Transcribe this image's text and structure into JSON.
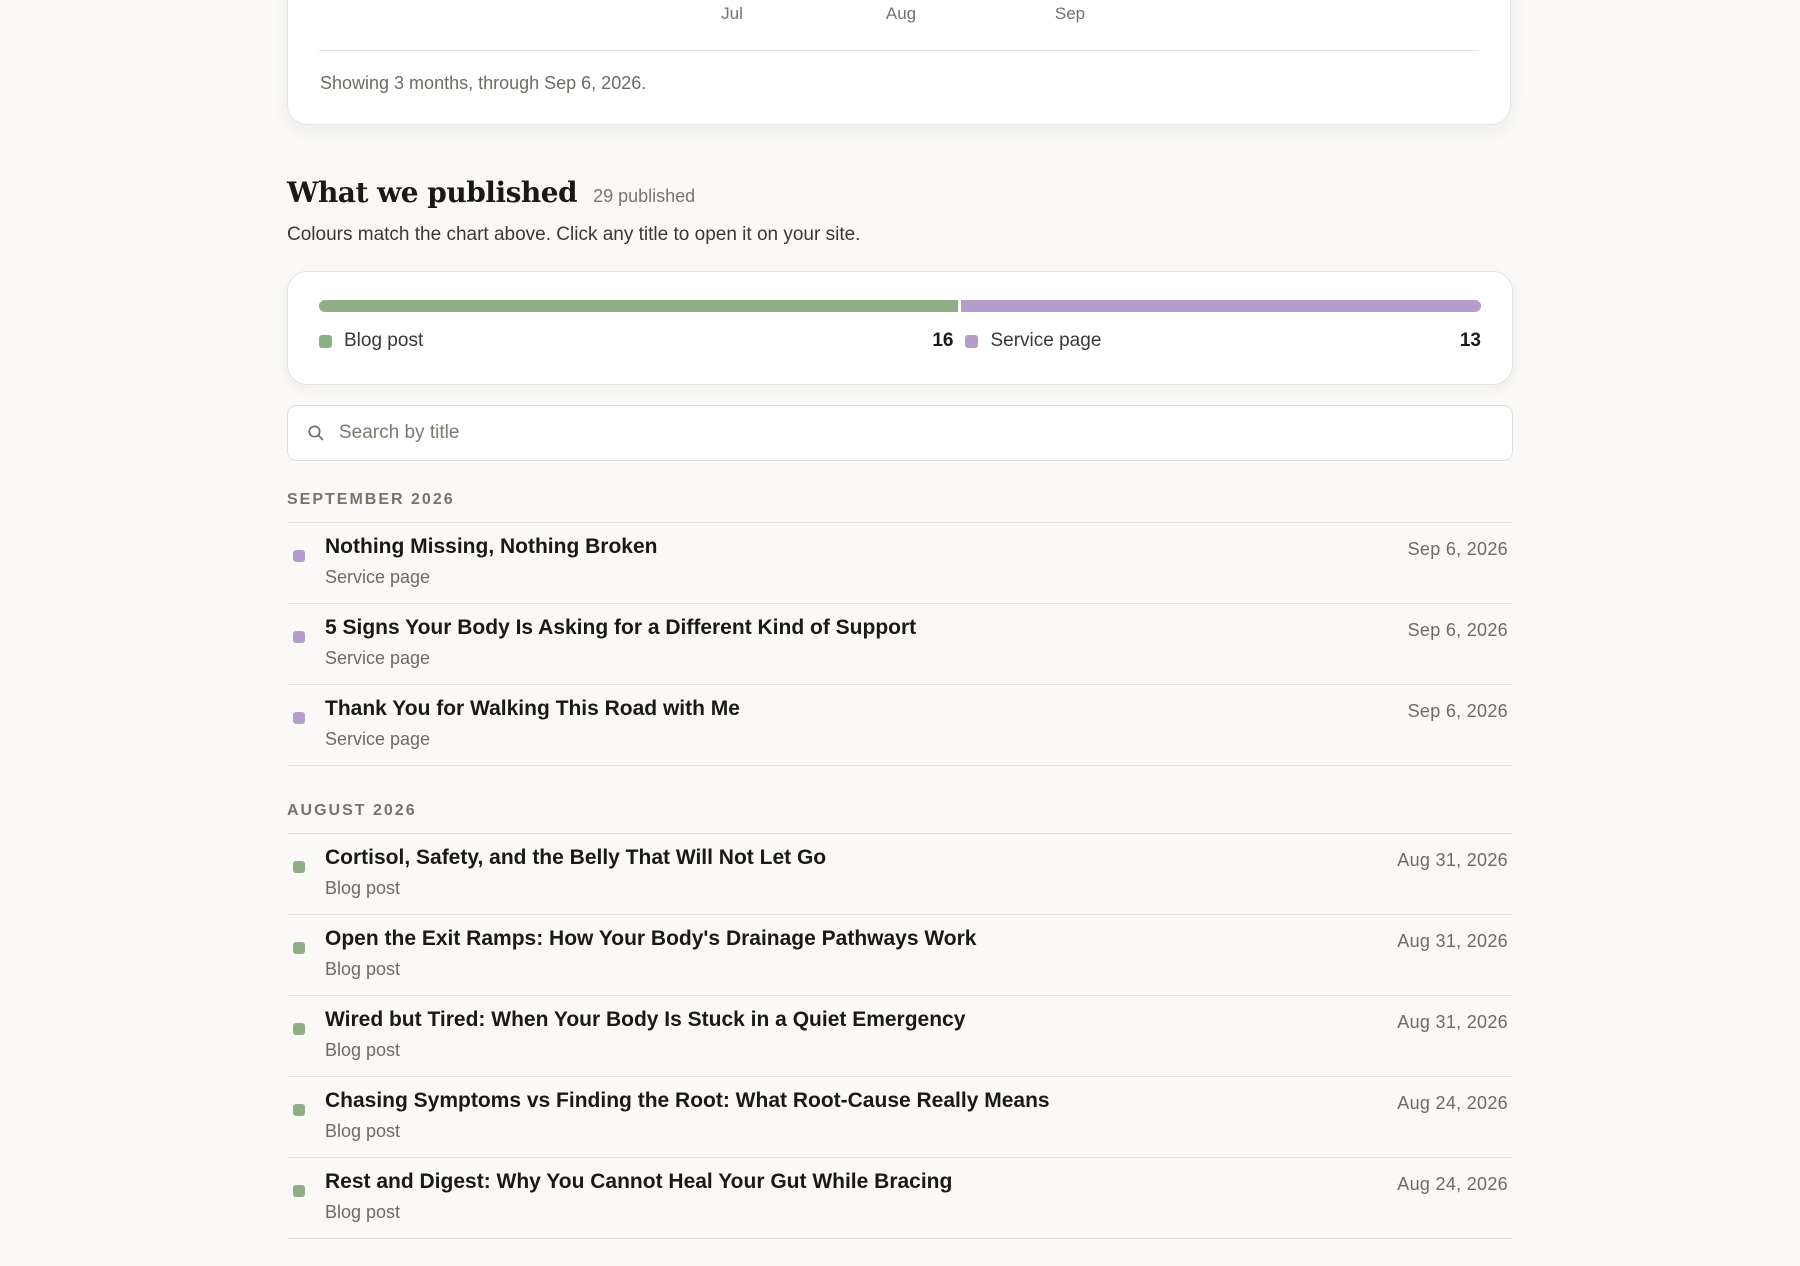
{
  "chart": {
    "ticks": [
      "Jul",
      "Aug",
      "Sep"
    ],
    "footnote": "Showing 3 months, through Sep 6, 2026."
  },
  "section": {
    "title": "What we published",
    "count": "29 published",
    "subtitle": "Colours match the chart above. Click any title to open it on your site."
  },
  "split": {
    "segments": [
      {
        "label": "Blog post",
        "count": 16,
        "color": "#8fae86"
      },
      {
        "label": "Service page",
        "count": 13,
        "color": "#b59ccb"
      }
    ]
  },
  "search": {
    "placeholder": "Search by title"
  },
  "months": [
    {
      "label": "SEPTEMBER 2026",
      "items": [
        {
          "title": "Nothing Missing, Nothing Broken",
          "type": "Service page",
          "date": "Sep 6, 2026"
        },
        {
          "title": "5 Signs Your Body Is Asking for a Different Kind of Support",
          "type": "Service page",
          "date": "Sep 6, 2026"
        },
        {
          "title": "Thank You for Walking This Road with Me",
          "type": "Service page",
          "date": "Sep 6, 2026"
        }
      ]
    },
    {
      "label": "AUGUST 2026",
      "items": [
        {
          "title": "Cortisol, Safety, and the Belly That Will Not Let Go",
          "type": "Blog post",
          "date": "Aug 31, 2026"
        },
        {
          "title": "Open the Exit Ramps: How Your Body's Drainage Pathways Work",
          "type": "Blog post",
          "date": "Aug 31, 2026"
        },
        {
          "title": "Wired but Tired: When Your Body Is Stuck in a Quiet Emergency",
          "type": "Blog post",
          "date": "Aug 31, 2026"
        },
        {
          "title": "Chasing Symptoms vs Finding the Root: What Root-Cause Really Means",
          "type": "Blog post",
          "date": "Aug 24, 2026"
        },
        {
          "title": "Rest and Digest: Why You Cannot Heal Your Gut While Bracing",
          "type": "Blog post",
          "date": "Aug 24, 2026"
        }
      ]
    }
  ],
  "colors": {
    "Blog post": "#8fae86",
    "Service page": "#b59ccb"
  }
}
